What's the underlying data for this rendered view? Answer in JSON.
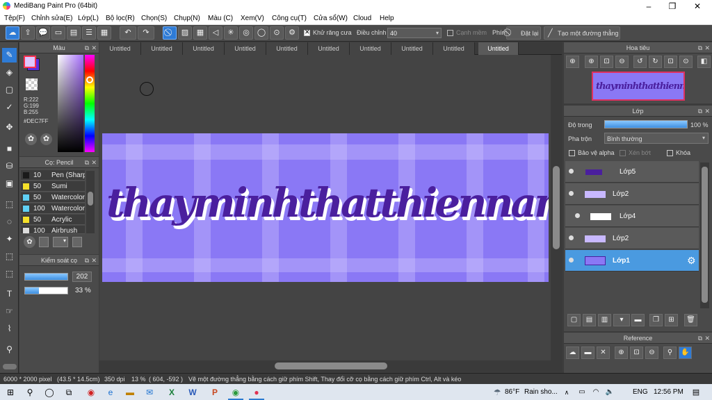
{
  "window": {
    "title": "MediBang Paint Pro (64bit)"
  },
  "menu": [
    "Tệp(F)",
    "Chỉnh sửa(E)",
    "Lớp(L)",
    "Bộ lọc(R)",
    "Chọn(S)",
    "Chụp(N)",
    "Màu (C)",
    "Xem(V)",
    "Công cụ(T)",
    "Cửa sổ(W)",
    "Cloud",
    "Help"
  ],
  "toolbar": {
    "antialias_label": "Khử răng cưa",
    "adjust_label": "Điều chỉnh",
    "adjust_value": "40",
    "edge_soft_label": "Cạnh mềm",
    "key_label": "Phím",
    "reset_label": "Đặt lại",
    "line_label": "Tạo một đường thẳng"
  },
  "color_panel": {
    "title": "Màu",
    "r": "R:222",
    "g": "G:199",
    "b": "B:255",
    "hex": "#DEC7FF",
    "fg_color": "#DEC7FF"
  },
  "brush_panel": {
    "title": "Cọ: Pencil",
    "items": [
      {
        "size": "10",
        "name": "Pen (Sharp",
        "color": "#1a1a1a"
      },
      {
        "size": "50",
        "name": "Sumi",
        "color": "#f5e12a"
      },
      {
        "size": "50",
        "name": "Watercolor",
        "color": "#5fd0f5"
      },
      {
        "size": "100",
        "name": "Watercolor",
        "color": "#5fd0f5"
      },
      {
        "size": "50",
        "name": "Acrylic",
        "color": "#f5e12a"
      },
      {
        "size": "100",
        "name": "Airbrush",
        "color": "#dddddd"
      }
    ]
  },
  "control_panel": {
    "title": "Kiểm soát cọ",
    "size_value": "202",
    "opacity_value": "33 %",
    "opacity_level": 0.33
  },
  "tabs": [
    "Untitled",
    "Untitled",
    "Untitled",
    "Untitled",
    "Untitled",
    "Untitled",
    "Untitled",
    "Untitled",
    "Untitled",
    "Untitled"
  ],
  "artwork": {
    "text": "thayminhthatthiennang",
    "bg_color": "#8a78f5",
    "text_color": "#4a1f9e"
  },
  "navigator": {
    "title": "Hoa tiêu"
  },
  "layer_panel": {
    "title": "Lớp",
    "opacity_label": "Độ trong",
    "opacity_value": "100 %",
    "blend_label": "Pha trộn",
    "blend_value": "Bình thường",
    "protect_alpha_label": "Bảo vệ alpha",
    "clip_label": "Xén bớt",
    "lock_label": "Khóa",
    "layers": [
      {
        "name": "Lớp5",
        "selected": false
      },
      {
        "name": "Lớp2",
        "selected": false
      },
      {
        "name": "Lớp4",
        "selected": false
      },
      {
        "name": "Lớp2",
        "selected": false
      },
      {
        "name": "Lớp1",
        "selected": true
      }
    ]
  },
  "reference_panel": {
    "title": "Reference"
  },
  "status": {
    "size": "6000 * 2000 pixel",
    "dims": "(43.5 * 14.5cm)",
    "dpi": "350 dpi",
    "zoom": "13 %",
    "coords": "( 604, -592 )",
    "hint": "Vẽ một đường thẳng bằng cách giữ phím Shift, Thay đổi cỡ cọ bằng cách giữ phím Ctrl, Alt và kéo"
  },
  "taskbar": {
    "weather_temp": "86°F",
    "weather_text": "Rain sho...",
    "lang": "ENG",
    "time": "12:56 PM"
  }
}
